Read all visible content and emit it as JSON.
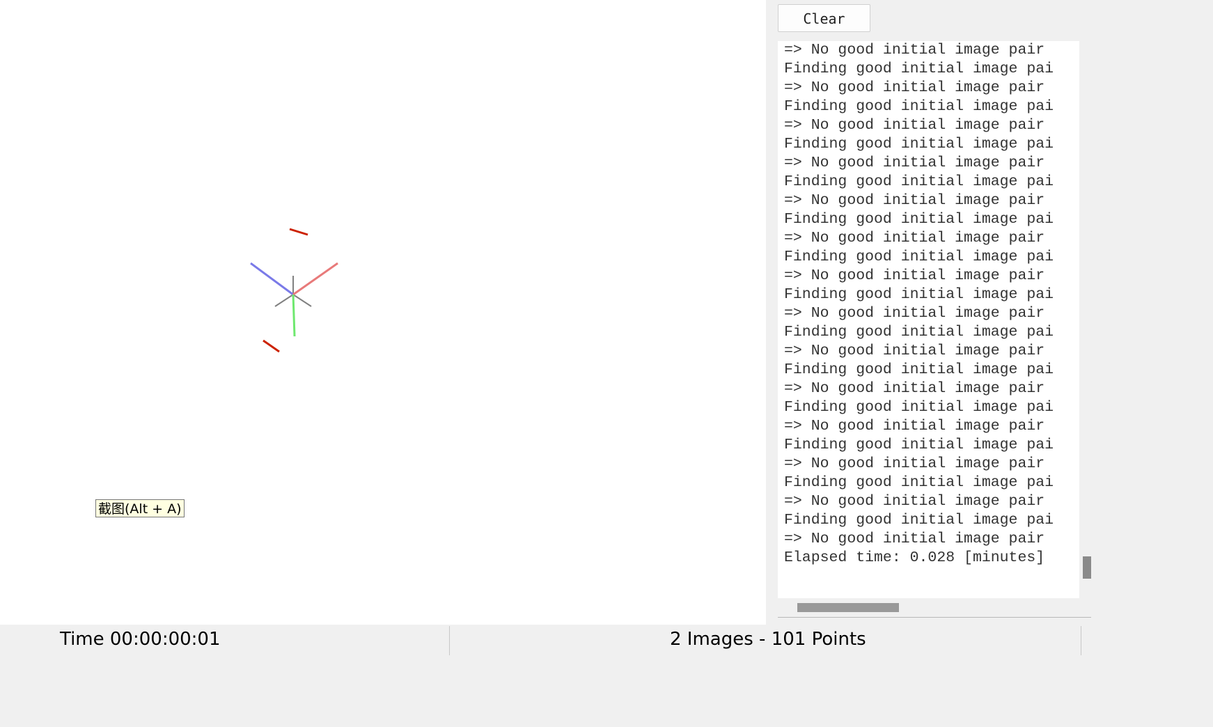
{
  "viewport": {
    "tooltip_text": "截图(Alt + A)",
    "axis_colors": {
      "x_axis": "#e87a7a",
      "y_axis": "#6fe86f",
      "z_axis": "#7a7ae8",
      "grid": "#808080",
      "camera": "#cc2200"
    }
  },
  "log_panel": {
    "clear_label": "Clear",
    "lines": [
      "=> No good initial image pair",
      "Finding good initial image pai",
      "=> No good initial image pair",
      "Finding good initial image pai",
      "=> No good initial image pair",
      "Finding good initial image pai",
      "=> No good initial image pair",
      "Finding good initial image pai",
      "=> No good initial image pair",
      "Finding good initial image pai",
      "=> No good initial image pair",
      "Finding good initial image pai",
      "=> No good initial image pair",
      "Finding good initial image pai",
      "=> No good initial image pair",
      "Finding good initial image pai",
      "=> No good initial image pair",
      "Finding good initial image pai",
      "=> No good initial image pair",
      "Finding good initial image pai",
      "=> No good initial image pair",
      "Finding good initial image pai",
      "=> No good initial image pair",
      "Finding good initial image pai",
      "=> No good initial image pair",
      "Finding good initial image pai",
      "=> No good initial image pair",
      "Elapsed time: 0.028 [minutes]"
    ]
  },
  "statusbar": {
    "time_text": "Time 00:00:00:01",
    "count_text": "2 Images - 101 Points"
  }
}
